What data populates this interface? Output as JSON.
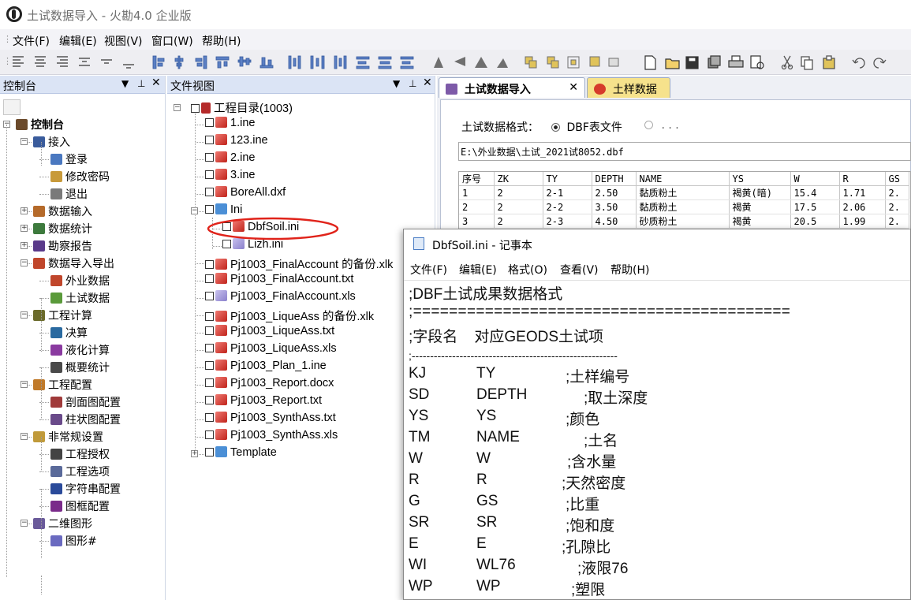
{
  "window": {
    "title": "土试数据导入 - 火勘4.0 企业版"
  },
  "menu": [
    "文件(F)",
    "编辑(E)",
    "视图(V)",
    "窗口(W)",
    "帮助(H)"
  ],
  "left_panel": {
    "title": "控制台",
    "tree": [
      {
        "label": "控制台",
        "level": 0,
        "expander": "-",
        "icon": "console-icon",
        "bold": true
      },
      {
        "label": "接入",
        "level": 1,
        "expander": "-",
        "icon": "access-icon"
      },
      {
        "label": "登录",
        "level": 2,
        "icon": "login-icon"
      },
      {
        "label": "修改密码",
        "level": 2,
        "icon": "password-icon"
      },
      {
        "label": "退出",
        "level": 2,
        "icon": "exit-icon"
      },
      {
        "label": "数据输入",
        "level": 1,
        "expander": "+",
        "icon": "data-input-icon"
      },
      {
        "label": "数据统计",
        "level": 1,
        "expander": "+",
        "icon": "data-stats-icon"
      },
      {
        "label": "勘察报告",
        "level": 1,
        "expander": "+",
        "icon": "report-icon"
      },
      {
        "label": "数据导入导出",
        "level": 1,
        "expander": "-",
        "icon": "import-export-icon"
      },
      {
        "label": "外业数据",
        "level": 2,
        "icon": "field-data-icon"
      },
      {
        "label": "土试数据",
        "level": 2,
        "icon": "soil-data-icon"
      },
      {
        "label": "工程计算",
        "level": 1,
        "expander": "-",
        "icon": "calc-icon"
      },
      {
        "label": "决算",
        "level": 2,
        "icon": "settle-icon"
      },
      {
        "label": "液化计算",
        "level": 2,
        "icon": "liquefy-icon"
      },
      {
        "label": "概要统计",
        "level": 2,
        "icon": "summary-icon"
      },
      {
        "label": "工程配置",
        "level": 1,
        "expander": "-",
        "icon": "config-icon"
      },
      {
        "label": "剖面图配置",
        "level": 2,
        "icon": "section-icon"
      },
      {
        "label": "柱状图配置",
        "level": 2,
        "icon": "column-icon"
      },
      {
        "label": "非常规设置",
        "level": 1,
        "expander": "-",
        "icon": "special-icon"
      },
      {
        "label": "工程授权",
        "level": 2,
        "icon": "license-icon"
      },
      {
        "label": "工程选项",
        "level": 2,
        "icon": "options-icon"
      },
      {
        "label": "字符串配置",
        "level": 2,
        "icon": "string-icon"
      },
      {
        "label": "图框配置",
        "level": 2,
        "icon": "frame-icon"
      },
      {
        "label": "二维图形",
        "level": 1,
        "expander": "-",
        "icon": "graphics-icon"
      },
      {
        "label": "图形#",
        "level": 2,
        "icon": "shape-icon"
      }
    ]
  },
  "file_panel": {
    "title": "文件视图",
    "root": "工程目录(1003)",
    "items": [
      {
        "label": "1.ine",
        "indent": 1
      },
      {
        "label": "123.ine",
        "indent": 1
      },
      {
        "label": "2.ine",
        "indent": 1
      },
      {
        "label": "3.ine",
        "indent": 1
      },
      {
        "label": "BoreAll.dxf",
        "indent": 1
      },
      {
        "label": "Ini",
        "indent": 1,
        "folder": true
      },
      {
        "label": "DbfSoil.ini",
        "indent": 2,
        "circled": true
      },
      {
        "label": "Lizh.ini",
        "indent": 2
      },
      {
        "label": "Pj1003_FinalAccount 的备份.xlk",
        "indent": 1
      },
      {
        "label": "Pj1003_FinalAccount.txt",
        "indent": 1
      },
      {
        "label": "Pj1003_FinalAccount.xls",
        "indent": 1
      },
      {
        "label": "Pj1003_LiqueAss 的备份.xlk",
        "indent": 1
      },
      {
        "label": "Pj1003_LiqueAss.txt",
        "indent": 1
      },
      {
        "label": "Pj1003_LiqueAss.xls",
        "indent": 1
      },
      {
        "label": "Pj1003_Plan_1.ine",
        "indent": 1
      },
      {
        "label": "Pj1003_Report.docx",
        "indent": 1
      },
      {
        "label": "Pj1003_Report.txt",
        "indent": 1
      },
      {
        "label": "Pj1003_SynthAss.txt",
        "indent": 1
      },
      {
        "label": "Pj1003_SynthAss.xls",
        "indent": 1
      },
      {
        "label": "Template",
        "indent": 1,
        "folder": true
      }
    ]
  },
  "tabs": [
    {
      "label": "土试数据导入",
      "active": true,
      "close": "✕"
    },
    {
      "label": "土样数据",
      "active": false
    }
  ],
  "import_form": {
    "format_label": "土试数据格式：",
    "option1": "DBF表文件",
    "option2": ". . .",
    "path": "E:\\外业数据\\土试_2021试8052.dbf",
    "columns": [
      "序号",
      "ZK",
      "TY",
      "DEPTH",
      "NAME",
      "YS",
      "W",
      "R",
      "GS"
    ],
    "rows": [
      [
        "1",
        "2",
        "2-1",
        "2.50",
        "黏质粉土",
        "褐黄(暗)",
        "15.4",
        "1.71",
        "2."
      ],
      [
        "2",
        "2",
        "2-2",
        "3.50",
        "黏质粉土",
        "褐黄",
        "17.5",
        "2.06",
        "2."
      ],
      [
        "3",
        "2",
        "2-3",
        "4.50",
        "砂质粉土",
        "褐黄",
        "20.5",
        "1.99",
        "2."
      ]
    ]
  },
  "notepad": {
    "title": "DbfSoil.ini - 记事本",
    "menu": [
      "文件(F)",
      "编辑(E)",
      "格式(O)",
      "查看(V)",
      "帮助(H)"
    ],
    "header_lines": [
      ";DBF土试成果数据格式",
      ";==========================================",
      ";字段名    对应GEODS土试项",
      ";--------------------------------------------------------"
    ],
    "rows": [
      [
        "KJ",
        "TY",
        ";土样编号"
      ],
      [
        "SD",
        "DEPTH",
        ";取土深度"
      ],
      [
        "YS",
        "YS",
        ";颜色"
      ],
      [
        "TM",
        "NAME",
        ";土名"
      ],
      [
        "W",
        "W",
        ";含水量"
      ],
      [
        "R",
        "R",
        ";天然密度"
      ],
      [
        "G",
        "GS",
        ";比重"
      ],
      [
        "SR",
        "SR",
        ";饱和度"
      ],
      [
        "E",
        "E",
        ";孔隙比"
      ],
      [
        "WI",
        "WL76",
        ";液限76"
      ],
      [
        "WP",
        "WP",
        ";塑限"
      ]
    ]
  }
}
